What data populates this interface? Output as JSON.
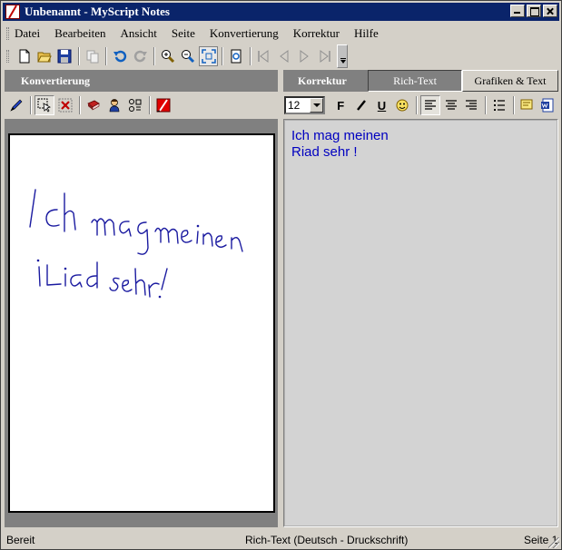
{
  "window": {
    "title": "Unbenannt - MyScript Notes"
  },
  "menu": {
    "items": [
      "Datei",
      "Bearbeiten",
      "Ansicht",
      "Seite",
      "Konvertierung",
      "Korrektur",
      "Hilfe"
    ]
  },
  "left_panel": {
    "title": "Konvertierung"
  },
  "right_panel": {
    "title": "Korrektur",
    "tabs": {
      "rich_text": "Rich-Text",
      "grafiken_text": "Grafiken & Text"
    },
    "font_size": "12",
    "format": {
      "bold": "F",
      "italic": "I",
      "underline": "U"
    },
    "text_lines": [
      "Ich mag meinen",
      "Riad sehr !"
    ]
  },
  "status": {
    "left": "Bereit",
    "mode": "Rich-Text (Deutsch - Druckschrift)",
    "page": "Seite 1"
  },
  "colors": {
    "title_bar": "#0a246a",
    "ink": "#1a1aa0",
    "recognized_text": "#0000c0"
  }
}
